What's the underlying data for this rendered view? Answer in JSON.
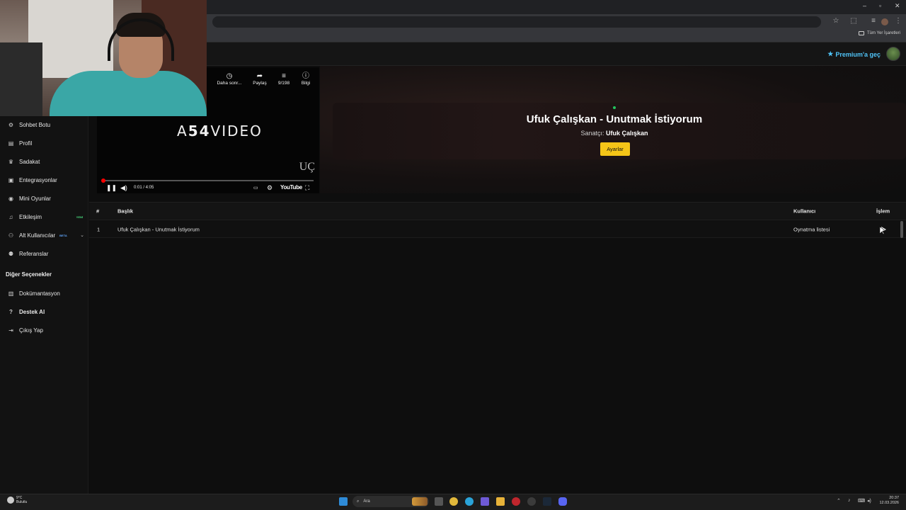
{
  "browser": {
    "window_controls": [
      "–",
      "▫",
      "✕"
    ],
    "bookmarks_all_label": "Tüm Yer İşaretleri"
  },
  "app": {
    "premium_label": "Premium'a geç",
    "colors": {
      "accent_premium": "#4fc3f7",
      "settings_button": "#f5c518",
      "new_badge": "#4ade80",
      "beta_badge": "#60a5fa"
    }
  },
  "sidebar": {
    "items": [
      {
        "label": "Sohbet Botu",
        "icon": "robot-icon"
      },
      {
        "label": "Profil",
        "icon": "id-card-icon"
      },
      {
        "label": "Sadakat",
        "icon": "trophy-icon"
      },
      {
        "label": "Entegrasyonlar",
        "icon": "plug-icon"
      },
      {
        "label": "Mini Oyunlar",
        "icon": "gamepad-icon"
      },
      {
        "label": "Etkileşim",
        "icon": "music-note-icon",
        "badge": "YENİ"
      },
      {
        "label": "Alt Kullanıcılar",
        "icon": "user-gear-icon",
        "badge": "BETA"
      },
      {
        "label": "Referanslar",
        "icon": "users-icon"
      }
    ],
    "section_title": "Diğer Seçenekler",
    "other_items": [
      {
        "label": "Dokümantasyon",
        "icon": "book-icon"
      },
      {
        "label": "Destek Al",
        "icon": "question-circle-icon"
      },
      {
        "label": "Çıkış Yap",
        "icon": "sign-out-icon"
      }
    ]
  },
  "player": {
    "top_controls": [
      {
        "label": "Daha sonr...",
        "icon": "clock-icon"
      },
      {
        "label": "Paylaş",
        "icon": "share-icon"
      },
      {
        "label": "9/198",
        "icon": "playlist-icon"
      },
      {
        "label": "Bilgi",
        "icon": "info-icon"
      }
    ],
    "brand_prefix": "A",
    "brand_bold": "54",
    "brand_suffix": "VIDEO",
    "watermark": "UÇ",
    "time": "0:01 / 4:05",
    "progress": 0.004,
    "youtube_label": "YouTube"
  },
  "now_playing": {
    "title": "Ufuk Çalışkan - Unutmak İstiyorum",
    "artist_label": "Sanatçı:",
    "artist": "Ufuk Çalışkan",
    "settings_button": "Ayarlar"
  },
  "table": {
    "headers": {
      "index": "#",
      "title": "Başlık",
      "user": "Kullanıcı",
      "action": "İşlem"
    },
    "rows": [
      {
        "index": "1",
        "title": "Ufuk Çalışkan - Unutmak İstiyorum",
        "user": "Oynatma listesi"
      }
    ]
  },
  "taskbar": {
    "weather_temp": "9°C",
    "weather_desc": "Bulutlu",
    "search_placeholder": "Ara",
    "time": "20:37",
    "date": "12.03.2026"
  }
}
